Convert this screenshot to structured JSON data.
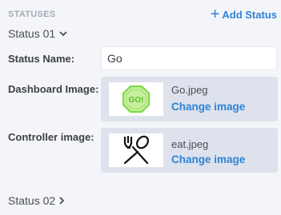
{
  "section": {
    "title": "STATUSES",
    "add_label": "Add Status"
  },
  "statuses": [
    {
      "label": "Status 01",
      "expanded": true,
      "name_label": "Status Name:",
      "name_value": "Go",
      "dashboard": {
        "label": "Dashboard Image:",
        "file": "Go.jpeg",
        "change_label": "Change image",
        "thumb_text": "GO!"
      },
      "controller": {
        "label": "Controller image:",
        "file": "eat.jpeg",
        "change_label": "Change image"
      }
    },
    {
      "label": "Status 02",
      "expanded": false
    }
  ],
  "colors": {
    "accent": "#2e83d6",
    "background": "#f4f5f9",
    "image_box": "#dde2ec",
    "section_title": "#a7abb6",
    "go_sign": "#7fd84a"
  },
  "icons": {
    "add": "plus-icon",
    "expanded": "chevron-down-icon",
    "collapsed": "chevron-right-icon"
  }
}
